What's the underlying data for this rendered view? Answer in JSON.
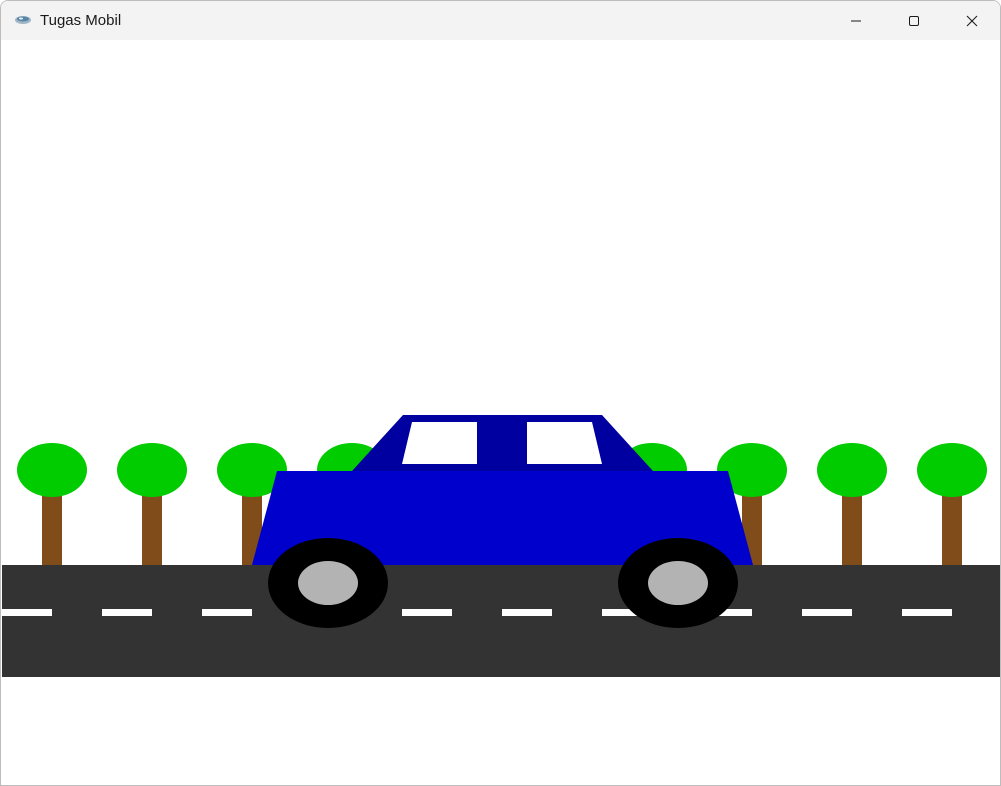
{
  "window": {
    "title": "Tugas Mobil",
    "controls": {
      "minimize_icon": "minimize-icon",
      "maximize_icon": "maximize-icon",
      "close_icon": "close-icon"
    }
  },
  "scene": {
    "colors": {
      "sky": "#ffffff",
      "road": "#333333",
      "lane_marking": "#ffffff",
      "tree_trunk": "#7f4c1a",
      "tree_canopy": "#00cc00",
      "car_body": "#0000cc",
      "car_cabin": "#0000a0",
      "car_window": "#ffffff",
      "tire": "#000000",
      "hubcap": "#b3b3b3"
    },
    "tree_count": 10,
    "lane_dash_count": 10,
    "wheel_count": 2
  }
}
